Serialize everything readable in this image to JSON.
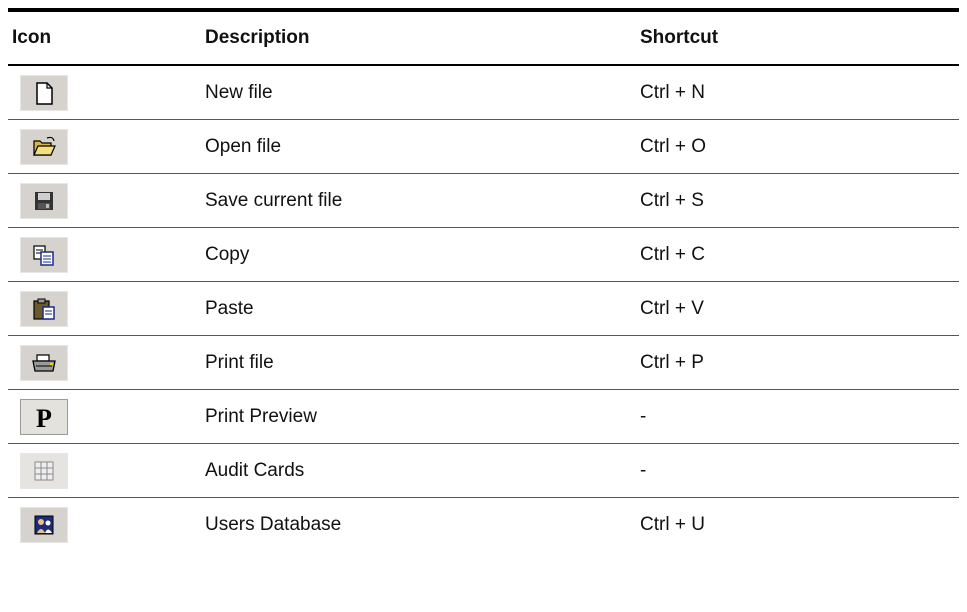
{
  "table": {
    "headers": {
      "icon": "Icon",
      "description": "Description",
      "shortcut": "Shortcut"
    },
    "rows": [
      {
        "icon": "new-file-icon",
        "description": "New file",
        "shortcut": "Ctrl + N"
      },
      {
        "icon": "open-folder-icon",
        "description": "Open file",
        "shortcut": "Ctrl + O"
      },
      {
        "icon": "floppy-disk-icon",
        "description": "Save current file",
        "shortcut": "Ctrl + S"
      },
      {
        "icon": "copy-icon",
        "description": "Copy",
        "shortcut": "Ctrl + C"
      },
      {
        "icon": "paste-clipboard-icon",
        "description": "Paste",
        "shortcut": "Ctrl + V"
      },
      {
        "icon": "printer-icon",
        "description": "Print file",
        "shortcut": "Ctrl + P"
      },
      {
        "icon": "print-preview-p-icon",
        "description": "Print Preview",
        "shortcut": "-"
      },
      {
        "icon": "grid-table-icon",
        "description": "Audit Cards",
        "shortcut": "-"
      },
      {
        "icon": "users-database-icon",
        "description": "Users Database",
        "shortcut": "Ctrl + U"
      }
    ]
  }
}
